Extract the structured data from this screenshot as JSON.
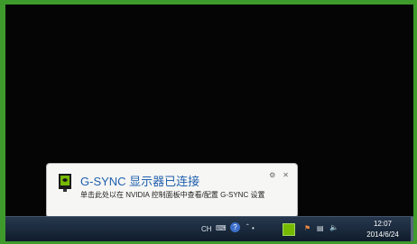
{
  "notification": {
    "title": "G-SYNC 显示器已连接",
    "body": "单击此处以在 NVIDIA 控制面板中查看/配置 G-SYNC 设置",
    "icons": [
      "nvidia-logo-icon",
      "settings-icon",
      "close-icon"
    ]
  },
  "tray": {
    "language_label": "CH",
    "icons": [
      "keyboard-icon",
      "help-icon",
      "chevron-icon",
      "nvidia-icon",
      "network-icon",
      "flag-icon",
      "volume-icon"
    ]
  },
  "clock": {
    "time": "12:07",
    "date": "2014/6/24"
  },
  "colors": {
    "border_green": "#3f9a2c",
    "title_blue": "#1f5fae",
    "nvidia_green": "#76b900"
  }
}
